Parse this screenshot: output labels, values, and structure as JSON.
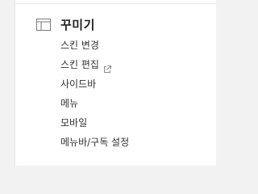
{
  "section": {
    "icon": "layout-icon",
    "title": "꾸미기"
  },
  "menu": {
    "items": [
      {
        "label": "스킨 변경"
      },
      {
        "label": "스킨 편집",
        "icon": "external-link-icon"
      },
      {
        "label": "사이드바"
      },
      {
        "label": "메뉴"
      },
      {
        "label": "모바일"
      },
      {
        "label": "메뉴바/구독 설정"
      }
    ]
  },
  "colors": {
    "text": "#333333",
    "title": "#222222",
    "icon": "#7a7a7a",
    "background": "#ffffff"
  }
}
